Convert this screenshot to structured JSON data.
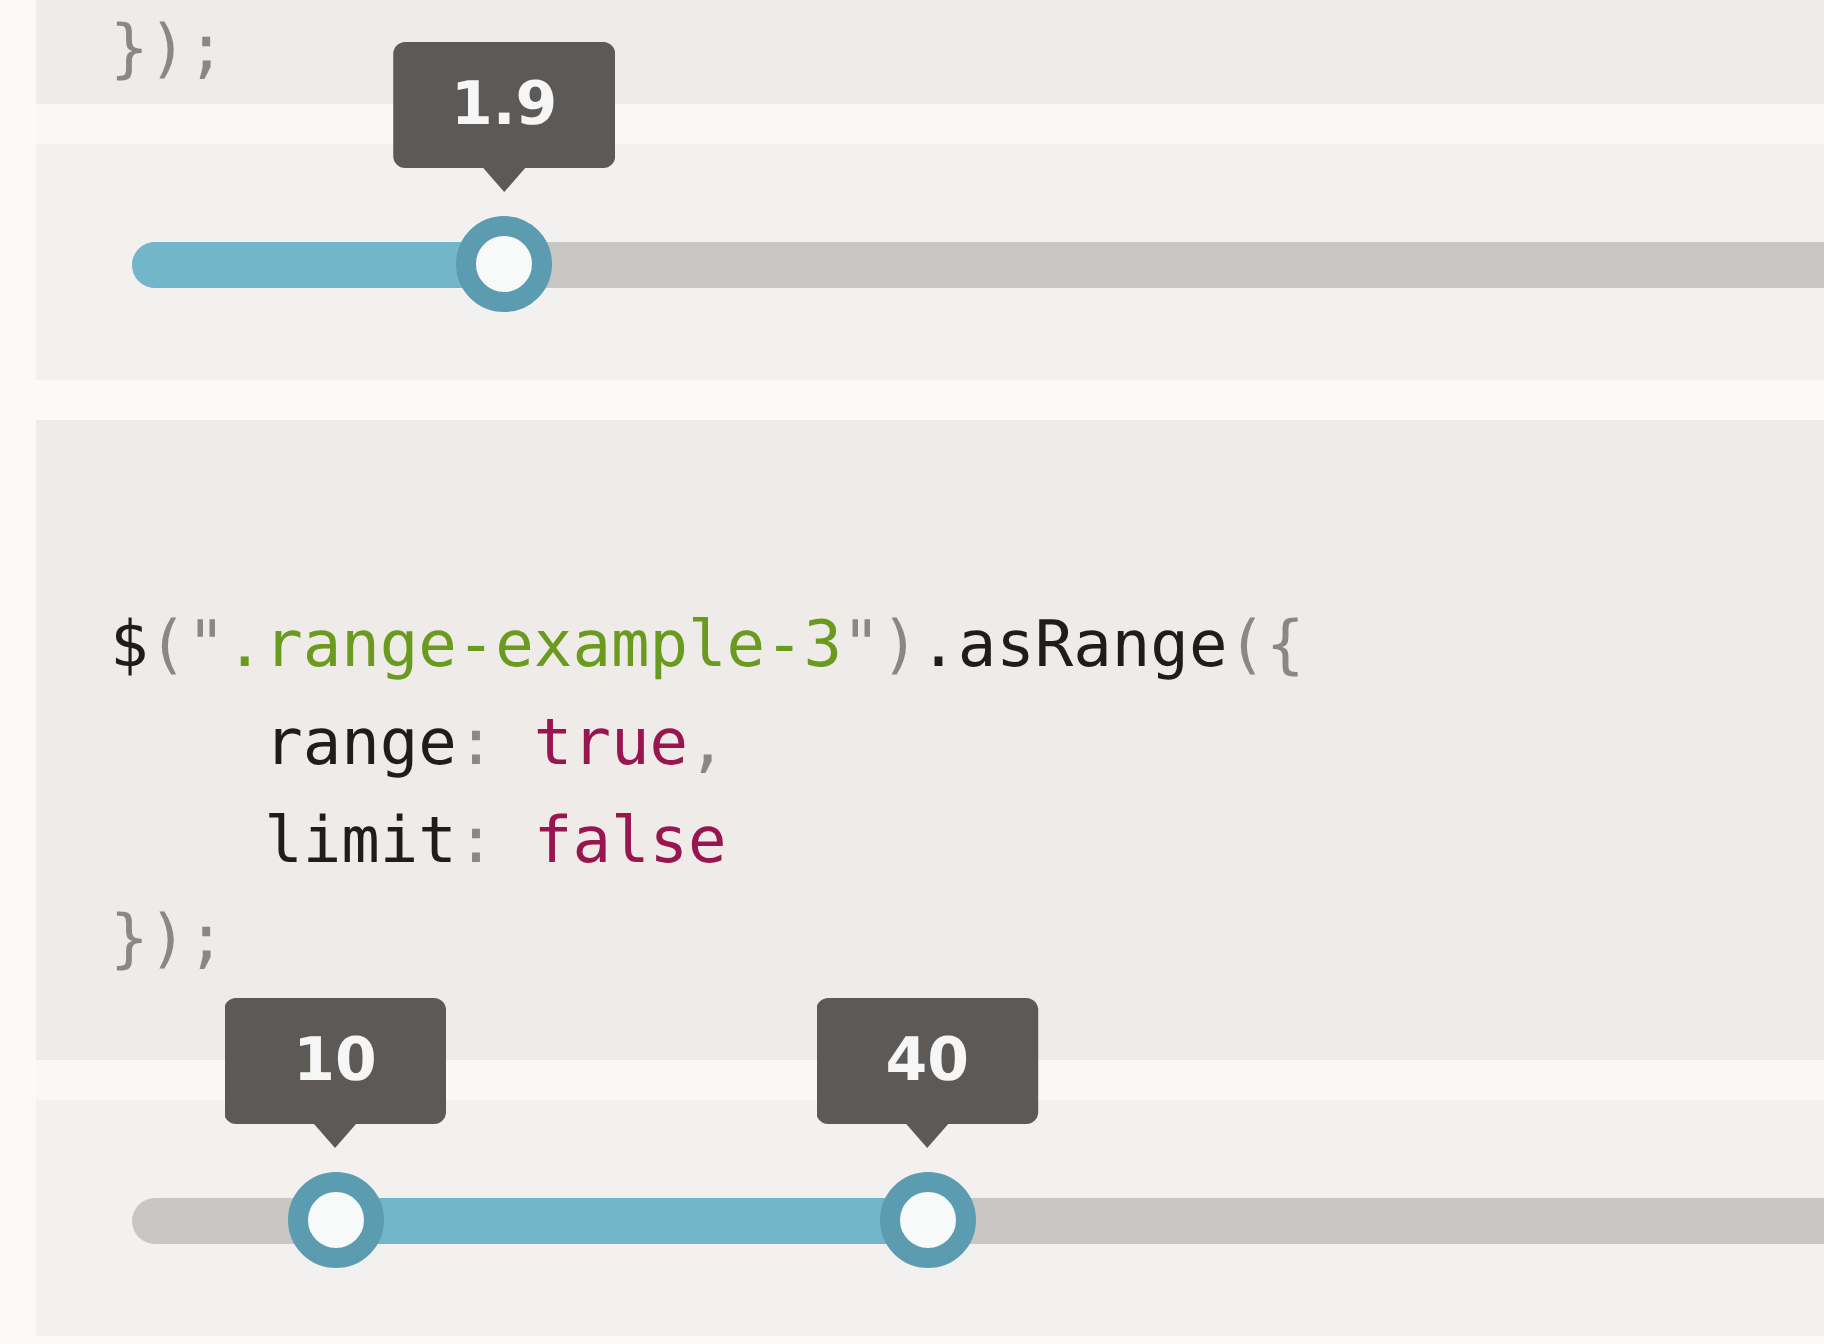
{
  "sections": [
    {
      "kind": "code",
      "lines": [
        {
          "indented": false,
          "tokens": [
            {
              "kind": "punct",
              "text": "});"
            }
          ]
        }
      ]
    },
    {
      "kind": "slider",
      "thumbs": [
        {
          "label": "1.9",
          "level": 0.22
        }
      ]
    },
    {
      "kind": "code",
      "lines": [
        {
          "indented": false,
          "tokens": [
            {
              "kind": "plain",
              "text": "$"
            },
            {
              "kind": "punct",
              "text": "(\""
            },
            {
              "kind": "string",
              "text": ".range-example-3"
            },
            {
              "kind": "punct",
              "text": "\")"
            },
            {
              "kind": "plain",
              "text": ".asRange"
            },
            {
              "kind": "punct",
              "text": "({"
            }
          ]
        },
        {
          "indented": true,
          "tokens": [
            {
              "kind": "plain",
              "text": "range"
            },
            {
              "kind": "punct",
              "text": ": "
            },
            {
              "kind": "bool",
              "text": "true"
            },
            {
              "kind": "punct",
              "text": ","
            }
          ]
        },
        {
          "indented": true,
          "tokens": [
            {
              "kind": "plain",
              "text": "limit"
            },
            {
              "kind": "punct",
              "text": ": "
            },
            {
              "kind": "bool",
              "text": "false"
            }
          ]
        },
        {
          "indented": false,
          "tokens": [
            {
              "kind": "punct",
              "text": "});"
            }
          ]
        }
      ]
    },
    {
      "kind": "slider",
      "thumbs": [
        {
          "label": "10",
          "level": 0.12
        },
        {
          "label": "40",
          "level": 0.47
        }
      ]
    }
  ]
}
